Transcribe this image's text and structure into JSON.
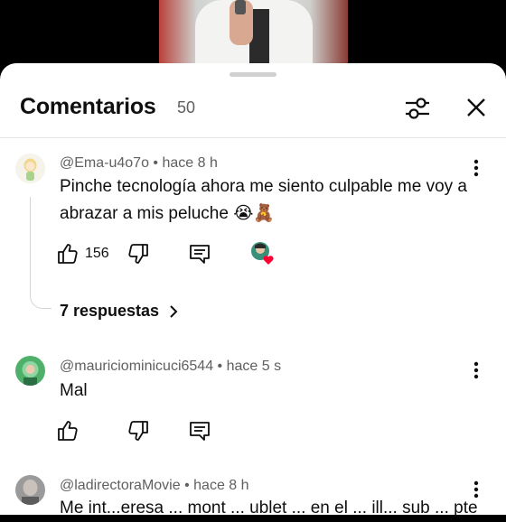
{
  "header": {
    "title": "Comentarios",
    "count": "50"
  },
  "comments": [
    {
      "author": "@Ema-u4o7o",
      "time": "hace 8 h",
      "text": "Pinche tecnología ahora me siento culpable me voy a abrazar a mis peluche 😭🧸",
      "likes": "156",
      "replies_label": "7 respuestas"
    },
    {
      "author": "@mauriciominicuci6544",
      "time": "hace 5 s",
      "text": "Mal"
    },
    {
      "author": "@ladirectoraMovie",
      "time": "hace 8 h",
      "text": "Me int...eresa ... mont ... ublet ... en el ... ill... sub ... pte"
    }
  ],
  "separator": "•",
  "colors": {
    "background": "#ffffff",
    "meta_text": "#606060",
    "heart": "#ff0033"
  },
  "icons": [
    "filter-icon",
    "close-icon",
    "more-vert-icon",
    "like-icon",
    "dislike-icon",
    "reply-icon",
    "creator-heart-icon",
    "chevron-right-icon"
  ]
}
